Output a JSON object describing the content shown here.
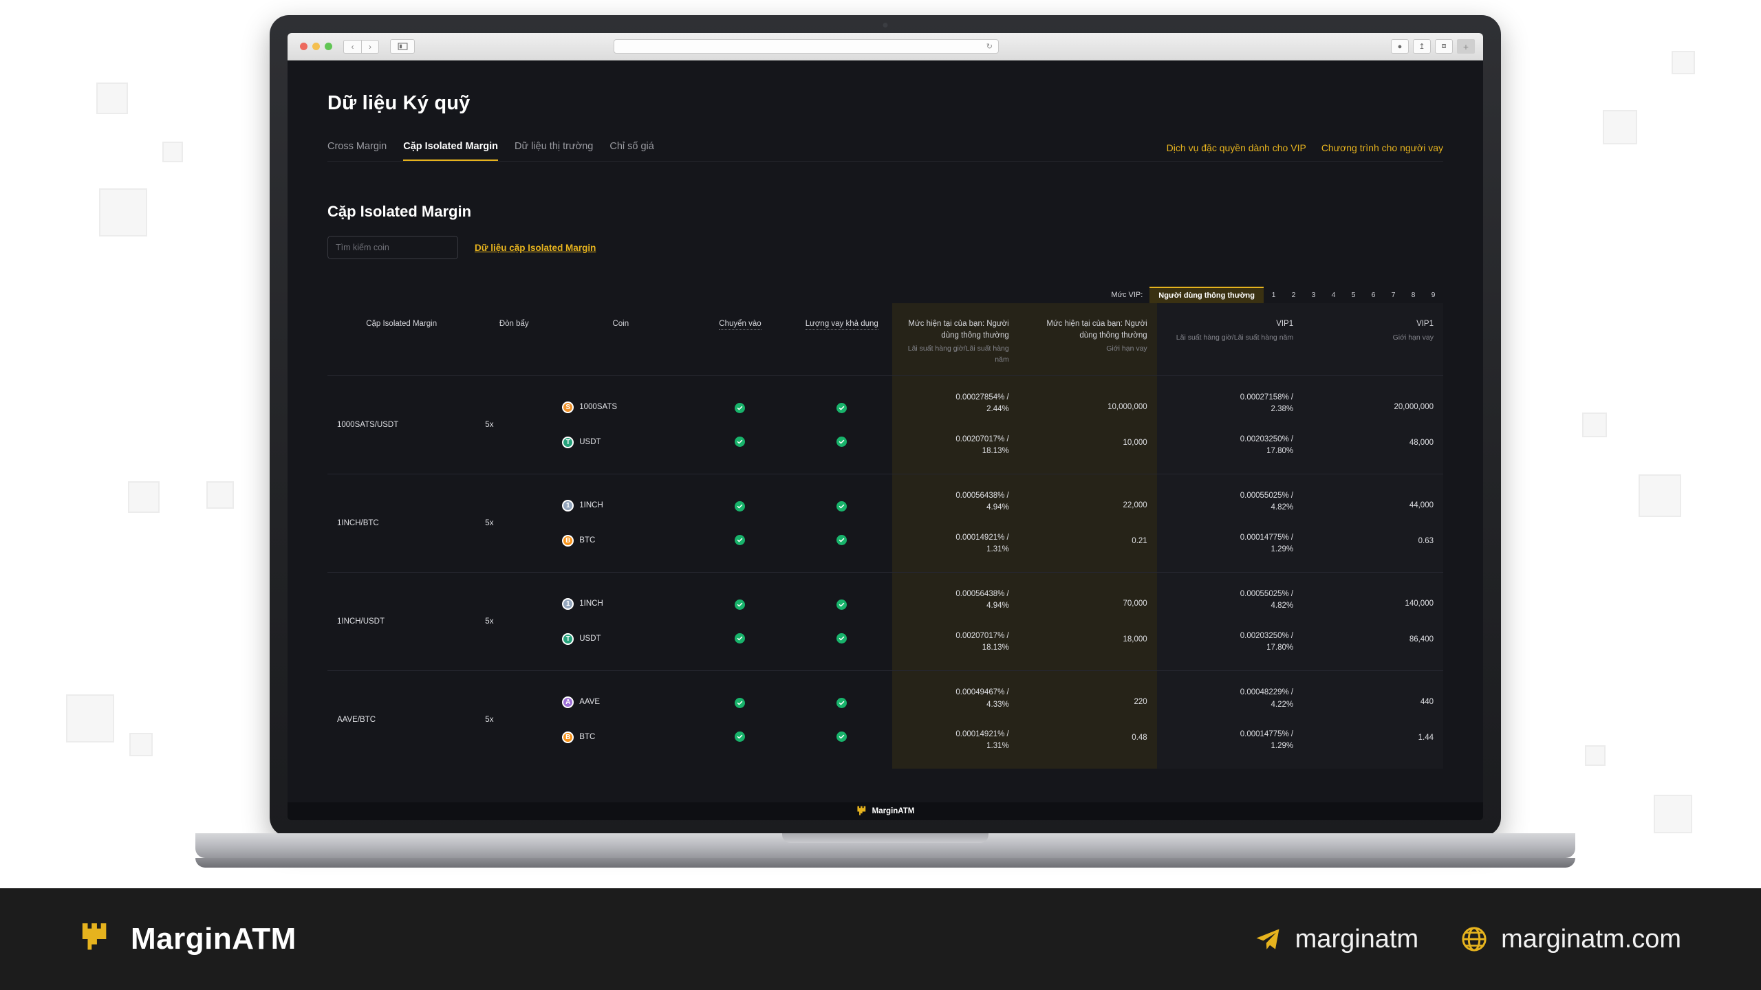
{
  "browser": {
    "reload_icon": "reload-icon",
    "url_value": "",
    "sidebar_icon": "sidebar-icon",
    "back_icon": "chevron-left-icon",
    "forward_icon": "chevron-right-icon",
    "download_icon": "download-icon",
    "share_icon": "share-icon",
    "copy_icon": "duplicate-icon",
    "new_tab_icon": "plus-icon"
  },
  "page": {
    "title": "Dữ liệu Ký quỹ",
    "tabs": [
      {
        "label": "Cross Margin",
        "active": false
      },
      {
        "label": "Cặp Isolated Margin",
        "active": true
      },
      {
        "label": "Dữ liệu thị trường",
        "active": false
      },
      {
        "label": "Chỉ số giá",
        "active": false
      }
    ],
    "top_links": [
      "Dịch vụ đặc quyền dành cho VIP",
      "Chương trình cho người vay"
    ],
    "section_title": "Cặp Isolated Margin",
    "search_placeholder": "Tìm kiếm coin",
    "search_value": "",
    "data_link": "Dữ liệu cặp Isolated Margin"
  },
  "vip_selector": {
    "label": "Mức VIP:",
    "active": "Người dùng thông thường",
    "levels": [
      "1",
      "2",
      "3",
      "4",
      "5",
      "6",
      "7",
      "8",
      "9"
    ]
  },
  "table": {
    "headers": {
      "pair": "Cặp Isolated Margin",
      "leverage": "Đòn bẩy",
      "coin": "Coin",
      "transfer_in": "Chuyển vào",
      "available_borrow": "Lượng vay khả dụng",
      "current_rate_main": "Mức hiện tại của bạn: Người dùng thông thường",
      "current_rate_sub": "Lãi suất hàng giờ/Lãi suất hàng năm",
      "current_limit_main": "Mức hiện tại của bạn: Người dùng thông thường",
      "current_limit_sub": "Giới hạn vay",
      "vip1_rate_main": "VIP1",
      "vip1_rate_sub": "Lãi suất hàng giờ/Lãi suất hàng năm",
      "vip1_limit_main": "VIP1",
      "vip1_limit_sub": "Giới hạn vay"
    },
    "rows": [
      {
        "pair": "1000SATS/USDT",
        "leverage": "5x",
        "coins": [
          {
            "symbol": "1000SATS",
            "glyph": "S",
            "color": "#f0922b",
            "transfer": true,
            "borrow": true
          },
          {
            "symbol": "USDT",
            "glyph": "T",
            "color": "#26a17b",
            "transfer": true,
            "borrow": true
          }
        ],
        "cur_rate": [
          "0.00027854% / 2.44%",
          "0.00207017% / 18.13%"
        ],
        "cur_limit": [
          "10,000,000",
          "10,000"
        ],
        "vip1_rate": [
          "0.00027158% / 2.38%",
          "0.00203250% / 17.80%"
        ],
        "vip1_limit": [
          "20,000,000",
          "48,000"
        ]
      },
      {
        "pair": "1INCH/BTC",
        "leverage": "5x",
        "coins": [
          {
            "symbol": "1INCH",
            "glyph": "1",
            "color": "#94a6bd",
            "transfer": true,
            "borrow": true
          },
          {
            "symbol": "BTC",
            "glyph": "B",
            "color": "#f7931a",
            "transfer": true,
            "borrow": true
          }
        ],
        "cur_rate": [
          "0.00056438% / 4.94%",
          "0.00014921% / 1.31%"
        ],
        "cur_limit": [
          "22,000",
          "0.21"
        ],
        "vip1_rate": [
          "0.00055025% / 4.82%",
          "0.00014775% / 1.29%"
        ],
        "vip1_limit": [
          "44,000",
          "0.63"
        ]
      },
      {
        "pair": "1INCH/USDT",
        "leverage": "5x",
        "coins": [
          {
            "symbol": "1INCH",
            "glyph": "1",
            "color": "#94a6bd",
            "transfer": true,
            "borrow": true
          },
          {
            "symbol": "USDT",
            "glyph": "T",
            "color": "#26a17b",
            "transfer": true,
            "borrow": true
          }
        ],
        "cur_rate": [
          "0.00056438% / 4.94%",
          "0.00207017% / 18.13%"
        ],
        "cur_limit": [
          "70,000",
          "18,000"
        ],
        "vip1_rate": [
          "0.00055025% / 4.82%",
          "0.00203250% / 17.80%"
        ],
        "vip1_limit": [
          "140,000",
          "86,400"
        ]
      },
      {
        "pair": "AAVE/BTC",
        "leverage": "5x",
        "coins": [
          {
            "symbol": "AAVE",
            "glyph": "A",
            "color": "#9c6fd6",
            "transfer": true,
            "borrow": true
          },
          {
            "symbol": "BTC",
            "glyph": "B",
            "color": "#f7931a",
            "transfer": true,
            "borrow": true
          }
        ],
        "cur_rate": [
          "0.00049467% / 4.33%",
          "0.00014921% / 1.31%"
        ],
        "cur_limit": [
          "220",
          "0.48"
        ],
        "vip1_rate": [
          "0.00048229% / 4.22%",
          "0.00014775% / 1.29%"
        ],
        "vip1_limit": [
          "440",
          "1.44"
        ]
      }
    ]
  },
  "screen_brand": {
    "name": "MarginATM",
    "logo": "castle-logo-icon"
  },
  "footer": {
    "brand": "MarginATM",
    "logo": "castle-logo-icon",
    "telegram_icon": "telegram-icon",
    "telegram_handle": "marginatm",
    "globe_icon": "globe-icon",
    "website": "marginatm.com"
  },
  "colors": {
    "accent": "#e6b31e",
    "page_bg": "#15161b",
    "highlight_col": "#262318",
    "alt_col": "#191a1f",
    "check_green": "#18b36b",
    "footer_bg": "#1c1c1c"
  }
}
